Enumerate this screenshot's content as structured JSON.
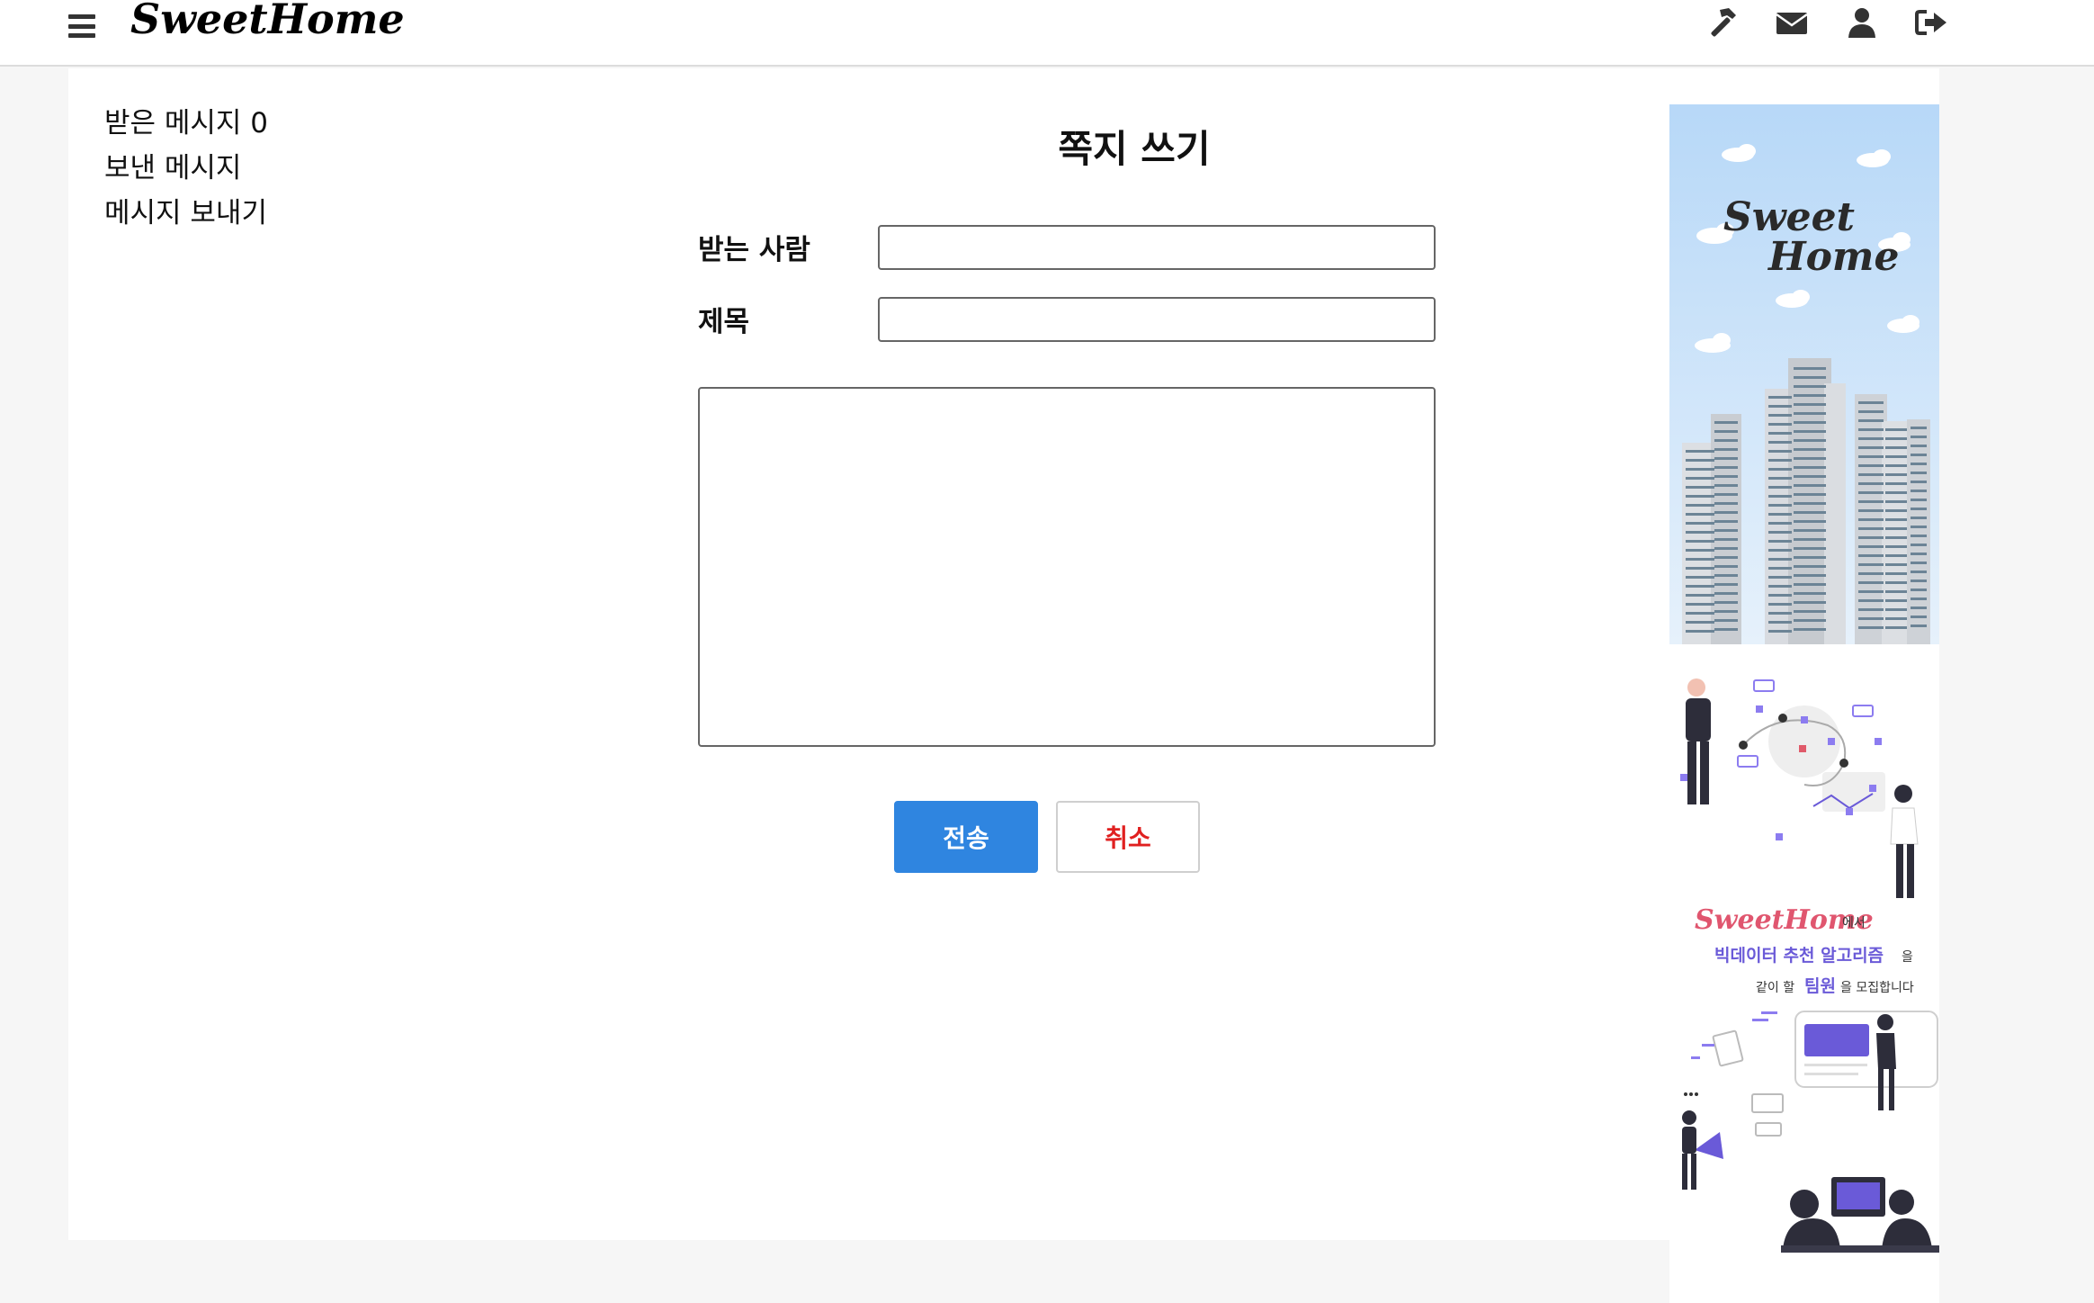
{
  "header": {
    "logo": "SweetHome",
    "icons": [
      "menu-icon",
      "hammer-icon",
      "envelope-icon",
      "user-icon",
      "sign-out-icon"
    ]
  },
  "sidebar": {
    "items": [
      {
        "label": "받은 메시지 0"
      },
      {
        "label": "보낸 메시지"
      },
      {
        "label": "메시지 보내기"
      }
    ]
  },
  "form": {
    "title": "쪽지 쓰기",
    "recipient_label": "받는 사람",
    "recipient_value": "",
    "subject_label": "제목",
    "subject_value": "",
    "body_value": "",
    "send_label": "전송",
    "cancel_label": "취소"
  },
  "ads": {
    "banner1": {
      "line1": "Sweet",
      "line2": "Home"
    },
    "banner2": {
      "brand": "SweetHome",
      "brand_suffix": "에서",
      "line2_a": "빅데이터 추천 알고리즘",
      "line2_b": "을",
      "line3_a": "같이 할 ",
      "line3_b": "팀원",
      "line3_c": "을 모집합니다"
    }
  },
  "colors": {
    "accent": "#2f85e0",
    "cancel_text": "#e02020",
    "page_bg": "#f6f6f6",
    "sky": "#b7d8f8",
    "ad_brand": "#e0566f",
    "ad_highlight": "#6a5ad8"
  }
}
